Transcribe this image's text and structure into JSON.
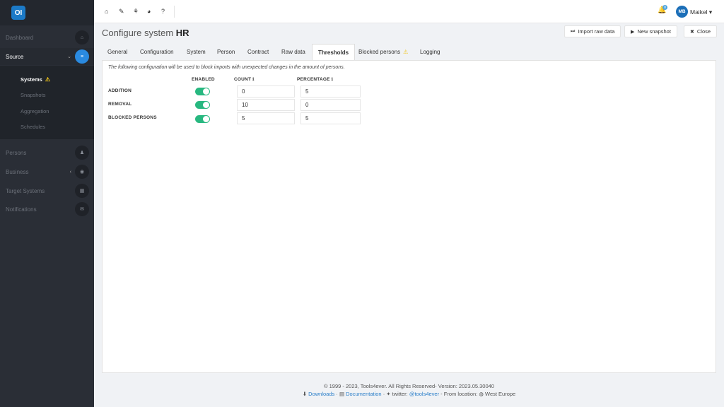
{
  "app": {
    "logo_text": "OI"
  },
  "sidebar": {
    "items": [
      {
        "label": "Dashboard",
        "icon": "home-icon",
        "glyph": "⌂"
      },
      {
        "label": "Source",
        "icon": "database-icon",
        "glyph": "≡"
      },
      {
        "label": "Persons",
        "icon": "users-icon",
        "glyph": "♟"
      },
      {
        "label": "Business",
        "icon": "business-icon",
        "glyph": "◉"
      },
      {
        "label": "Target Systems",
        "icon": "grid-icon",
        "glyph": "▦"
      },
      {
        "label": "Notifications",
        "icon": "envelope-icon",
        "glyph": "✉"
      }
    ],
    "sub_items": [
      "Systems",
      "Snapshots",
      "Aggregation",
      "Schedules"
    ]
  },
  "topbar": {
    "icons": [
      "home-icon",
      "wrench-icon",
      "network-icon",
      "chart-icon",
      "help-icon"
    ],
    "notification_count": "0",
    "avatar_initials": "MB",
    "username": "Maikel"
  },
  "page": {
    "title_prefix": "Configure system",
    "title_name": "HR",
    "buttons": {
      "import": "Import raw data",
      "snapshot": "New snapshot",
      "close": "Close"
    }
  },
  "tabs": [
    "General",
    "Configuration",
    "System",
    "Person",
    "Contract",
    "Raw data",
    "Thresholds",
    "Blocked persons",
    "Logging"
  ],
  "thresholds": {
    "description": "The following configuration will be used to block imports with unexpected changes in the amount of persons.",
    "columns": {
      "enabled": "ENABLED",
      "count": "COUNT",
      "percentage": "PERCENTAGE"
    },
    "rows": [
      {
        "label": "ADDITION",
        "enabled": true,
        "count": "0",
        "percentage": "5"
      },
      {
        "label": "REMOVAL",
        "enabled": true,
        "count": "10",
        "percentage": "0"
      },
      {
        "label": "BLOCKED PERSONS",
        "enabled": true,
        "count": "5",
        "percentage": "5"
      }
    ]
  },
  "footer": {
    "line1": "© 1999 - 2023, Tools4ever. All Rights Reserved- Version: 2023.05.30040",
    "downloads": "Downloads",
    "documentation": "Documentation",
    "twitter_label": "twitter:",
    "twitter_handle": "@tools4ever",
    "location_label": "- From location:",
    "location": "West Europe"
  }
}
